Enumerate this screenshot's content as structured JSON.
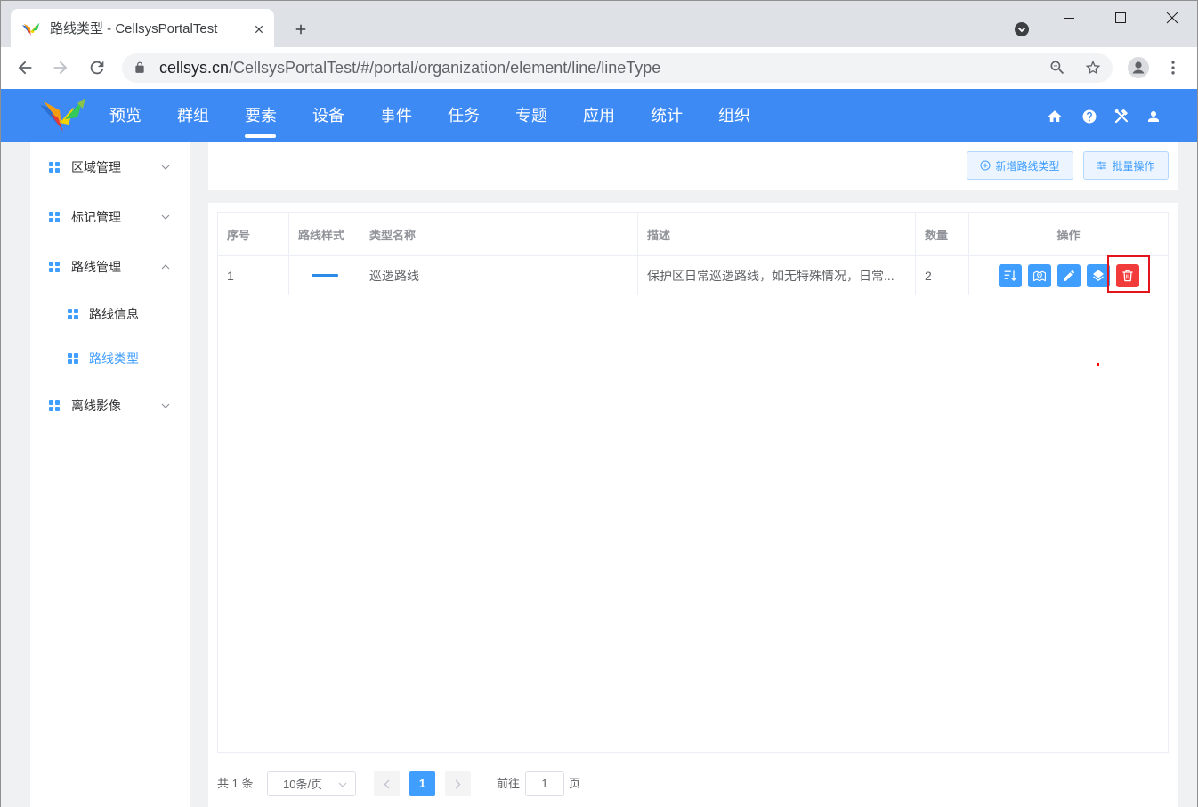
{
  "browser": {
    "tab_title": "路线类型 - CellsysPortalTest",
    "url_host": "cellsys.cn",
    "url_path": "/CellsysPortalTest/#/portal/organization/element/line/lineType"
  },
  "header": {
    "nav": [
      {
        "label": "预览"
      },
      {
        "label": "群组"
      },
      {
        "label": "要素",
        "active": true
      },
      {
        "label": "设备"
      },
      {
        "label": "事件"
      },
      {
        "label": "任务"
      },
      {
        "label": "专题"
      },
      {
        "label": "应用"
      },
      {
        "label": "统计"
      },
      {
        "label": "组织"
      }
    ],
    "right_icons": [
      "home-icon",
      "help-icon",
      "tools-icon",
      "user-icon"
    ]
  },
  "sidebar": {
    "items": [
      {
        "label": "区域管理",
        "icon": "grid-icon",
        "expanded": false
      },
      {
        "label": "标记管理",
        "icon": "grid-icon",
        "expanded": false
      },
      {
        "label": "路线管理",
        "icon": "grid-icon",
        "expanded": true,
        "children": [
          {
            "label": "路线信息",
            "icon": "grid-icon",
            "active": false
          },
          {
            "label": "路线类型",
            "icon": "grid-icon",
            "active": true
          }
        ]
      },
      {
        "label": "离线影像",
        "icon": "grid-icon",
        "expanded": false
      }
    ]
  },
  "toolbar": {
    "add_button": {
      "label": "新增路线类型",
      "icon": "add-circle-icon"
    },
    "batch_button": {
      "label": "批量操作",
      "icon": "operation-icon"
    }
  },
  "table": {
    "columns": [
      "序号",
      "路线样式",
      "类型名称",
      "描述",
      "数量",
      "操作"
    ],
    "rows": [
      {
        "index": "1",
        "line_color": "#2a8ae8",
        "name": "巡逻路线",
        "description": "保护区日常巡逻路线，如无特殊情况，日常...",
        "count": "2"
      }
    ],
    "row_actions": [
      {
        "icon": "sort-icon"
      },
      {
        "icon": "map-icon"
      },
      {
        "icon": "edit-icon"
      },
      {
        "icon": "layers-icon"
      },
      {
        "icon": "delete-icon",
        "highlighted": true
      }
    ]
  },
  "pagination": {
    "total_prefix": "共",
    "total": "1",
    "total_suffix": "条",
    "page_size": "10条/页",
    "current_page": "1",
    "goto_label": "前往",
    "goto_value": "1",
    "goto_suffix": "页"
  },
  "theme": {
    "header_bg": "#3e8af4",
    "primary": "#409eff",
    "danger": "#f23c3c",
    "highlight": "#e3141c"
  }
}
